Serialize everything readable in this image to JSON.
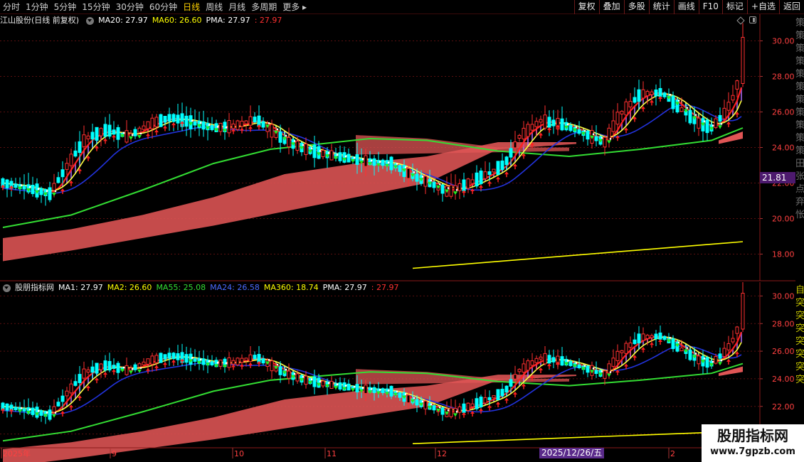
{
  "toolbar": {
    "periods": [
      "分时",
      "1分钟",
      "5分钟",
      "15分钟",
      "30分钟",
      "60分钟",
      "日线",
      "周线",
      "月线",
      "多周期",
      "更多"
    ],
    "active_period": "日线",
    "tools": [
      "复权",
      "叠加",
      "多股",
      "统计",
      "画线",
      "F10",
      "标记",
      "+自选",
      "返回"
    ]
  },
  "top_panel": {
    "title": "江山股份(日线 前复权)",
    "indicators": [
      {
        "label": "MA20: 27.97",
        "color": "#ffffff"
      },
      {
        "label": "MA60: 26.60",
        "color": "#ffff00"
      },
      {
        "label": "PMA: 27.97",
        "color": "#ffffff"
      },
      {
        "label": ": 27.97",
        "color": "#ff3030"
      }
    ],
    "price_tag": "21.81",
    "side_text": "策策策策策策策策策策策田张点弃怅"
  },
  "bottom_panel": {
    "title": "股朋指标网",
    "indicators": [
      {
        "label": "MA1: 27.97",
        "color": "#ffffff"
      },
      {
        "label": "MA2: 26.60",
        "color": "#ffff00"
      },
      {
        "label": "MA55: 25.08",
        "color": "#33dd33"
      },
      {
        "label": "MA24: 26.58",
        "color": "#4a6bff"
      },
      {
        "label": "MA360: 18.74",
        "color": "#ffff00"
      },
      {
        "label": "PMA: 27.97",
        "color": "#ffffff"
      },
      {
        "label": ": 27.97",
        "color": "#ff3030"
      }
    ],
    "side_text": "自突突突突突突突"
  },
  "date_axis": {
    "labels": [
      "2025年",
      "9",
      "10",
      "11",
      "12",
      "2"
    ],
    "highlight": "2025/12/26/五"
  },
  "watermark": {
    "title": "股朋指标网",
    "url": "www.7gpzb.com"
  },
  "chart_data": [
    {
      "type": "candlestick",
      "panel": "top",
      "y_ticks": [
        "30.00",
        "28.00",
        "26.00",
        "24.00",
        "22.00",
        "20.00",
        "18.00"
      ],
      "ylim": [
        16.5,
        31.5
      ],
      "x_labels": [
        "2025年",
        "9",
        "10",
        "11",
        "12",
        "2"
      ],
      "series": [
        {
          "name": "MA20",
          "color": "#ffffff"
        },
        {
          "name": "MA60",
          "color": "#ffff00"
        },
        {
          "name": "PMA",
          "color": "#ffffff"
        }
      ]
    },
    {
      "type": "candlestick",
      "panel": "bottom",
      "y_ticks": [
        "30.00",
        "28.00",
        "26.00",
        "24.00",
        "22.00",
        "20.00"
      ],
      "ylim": [
        19,
        31
      ],
      "series": [
        {
          "name": "MA1",
          "color": "#ffffff"
        },
        {
          "name": "MA2",
          "color": "#ffff00"
        },
        {
          "name": "MA55",
          "color": "#33dd33"
        },
        {
          "name": "MA24",
          "color": "#4a6bff"
        },
        {
          "name": "MA360",
          "color": "#ffff00"
        },
        {
          "name": "PMA",
          "color": "#ffffff"
        }
      ]
    }
  ],
  "colors": {
    "up": "#ff3030",
    "down": "#00ffff",
    "grid": "#5a0f0f",
    "band": "#e05555",
    "ma_green": "#33dd33",
    "ma_blue": "#2233dd",
    "ma_yellow": "#ffff00",
    "signal_green": "#22ee22",
    "signal_red": "#ff2020"
  }
}
